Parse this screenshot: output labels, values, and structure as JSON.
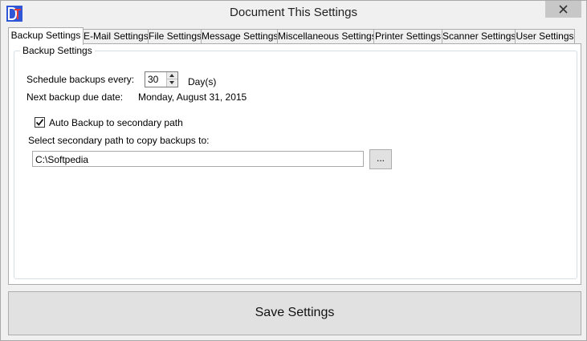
{
  "window": {
    "title": "Document This Settings"
  },
  "tabs": [
    {
      "label": "Backup Settings",
      "active": true
    },
    {
      "label": "E-Mail Settings",
      "active": false
    },
    {
      "label": "File Settings",
      "active": false
    },
    {
      "label": "Message Settings",
      "active": false
    },
    {
      "label": "Miscellaneous Settings",
      "active": false
    },
    {
      "label": "Printer Settings",
      "active": false
    },
    {
      "label": "Scanner Settings",
      "active": false
    },
    {
      "label": "User Settings",
      "active": false
    }
  ],
  "backup": {
    "group_label": "Backup Settings",
    "schedule_label": "Schedule backups every:",
    "schedule_value": "30",
    "schedule_unit": "Day(s)",
    "next_due_label": "Next backup due date:",
    "next_due_value": "Monday, August 31, 2015",
    "auto_backup_label": "Auto Backup to secondary path",
    "auto_backup_checked": true,
    "path_prompt": "Select secondary path to copy backups to:",
    "path_value": "C:\\Softpedia",
    "browse_label": "..."
  },
  "footer": {
    "save_label": "Save Settings"
  }
}
